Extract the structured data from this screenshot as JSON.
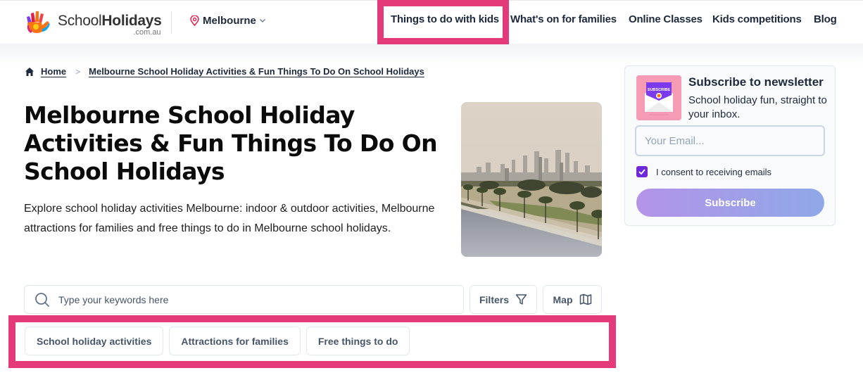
{
  "header": {
    "logo": {
      "word_regular": "School",
      "word_bold": "Holidays",
      "domain": ".com.au"
    },
    "location": {
      "label": "Melbourne",
      "icon": "map-pin-icon"
    },
    "nav": [
      {
        "label": "Things to do with kids",
        "highlighted": true
      },
      {
        "label": "What's on for families"
      },
      {
        "label": "Online Classes"
      },
      {
        "label": "Kids competitions"
      },
      {
        "label": "Blog"
      }
    ]
  },
  "breadcrumb": {
    "home": "Home",
    "separator": ">",
    "current": "Melbourne School Holiday Activities & Fun Things To Do On School Holidays"
  },
  "main": {
    "title": "Melbourne School Holiday Activities & Fun Things To Do On School Holidays",
    "intro": "Explore school holiday activities Melbourne: indoor & outdoor activities, Melbourne attractions for families and free things to do in Melbourne school holidays.",
    "hero_image_alt": "Melbourne city skyline over Albert Park Lake with palm trees"
  },
  "search": {
    "placeholder": "Type your keywords here",
    "value": "",
    "filters_label": "Filters",
    "map_label": "Map"
  },
  "categories": [
    {
      "label": "School holiday activities"
    },
    {
      "label": "Attractions for families"
    },
    {
      "label": "Free things to do"
    }
  ],
  "newsletter": {
    "title": "Subscribe to newsletter",
    "subtitle": "School holiday fun, straight to your inbox.",
    "email_placeholder": "Your Email...",
    "email_value": "",
    "consent_label": "I consent to receiving emails",
    "consent_checked": true,
    "button_label": "Subscribe",
    "image_badge": "SUBSCRIBE"
  },
  "colors": {
    "highlight": "#e43a7a",
    "text_dark": "#1e293b",
    "checkbox": "#6d28d9",
    "button_gradient_start": "#b494e8",
    "button_gradient_end": "#8ea8e8",
    "location_pin": "#e11d48"
  }
}
